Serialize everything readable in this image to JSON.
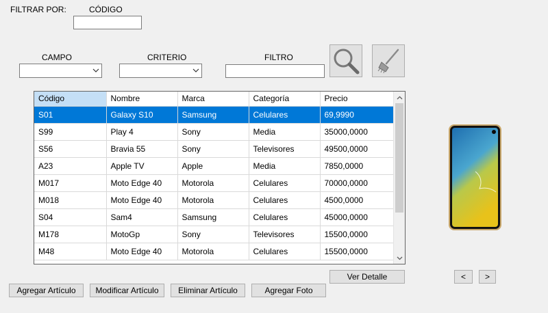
{
  "filter": {
    "filtrar_por_label": "FILTRAR POR:",
    "codigo_label": "CÓDIGO",
    "codigo_value": "",
    "campo_label": "CAMPO",
    "campo_value": "",
    "criterio_label": "CRITERIO",
    "criterio_value": "",
    "filtro_label": "FILTRO",
    "filtro_value": ""
  },
  "grid": {
    "columns": [
      "Código",
      "Nombre",
      "Marca",
      "Categoría",
      "Precio"
    ],
    "rows": [
      [
        "S01",
        "Galaxy S10",
        "Samsung",
        "Celulares",
        "69,9990"
      ],
      [
        "S99",
        "Play 4",
        "Sony",
        "Media",
        "35000,0000"
      ],
      [
        "S56",
        "Bravia 55",
        "Sony",
        "Televisores",
        "49500,0000"
      ],
      [
        "A23",
        "Apple TV",
        "Apple",
        "Media",
        "7850,0000"
      ],
      [
        "M017",
        "Moto Edge 40",
        "Motorola",
        "Celulares",
        "70000,0000"
      ],
      [
        "M018",
        "Moto Edge 40",
        "Motorola",
        "Celulares",
        "4500,0000"
      ],
      [
        "S04",
        "Sam4",
        "Samsung",
        "Celulares",
        "45000,0000"
      ],
      [
        "M178",
        "MotoGp",
        "Sony",
        "Televisores",
        "15500,0000"
      ],
      [
        "M48",
        "Moto Edge 40",
        "Motorola",
        "Celulares",
        "15500,0000"
      ]
    ],
    "selected_row": 0,
    "sorted_column": 0
  },
  "buttons": {
    "ver_detalle": "Ver Detalle",
    "agregar_articulo": "Agregar Artículo",
    "modificar_articulo": "Modificar Artículo",
    "eliminar_articulo": "Eliminar Artículo",
    "agregar_foto": "Agregar Foto",
    "prev": "<",
    "next": ">"
  },
  "icons": {
    "search": "search-icon",
    "clear": "broom-icon"
  },
  "colors": {
    "selection": "#0078d7",
    "header_sorted": "#c4dff6",
    "background": "#f0f0f0"
  }
}
